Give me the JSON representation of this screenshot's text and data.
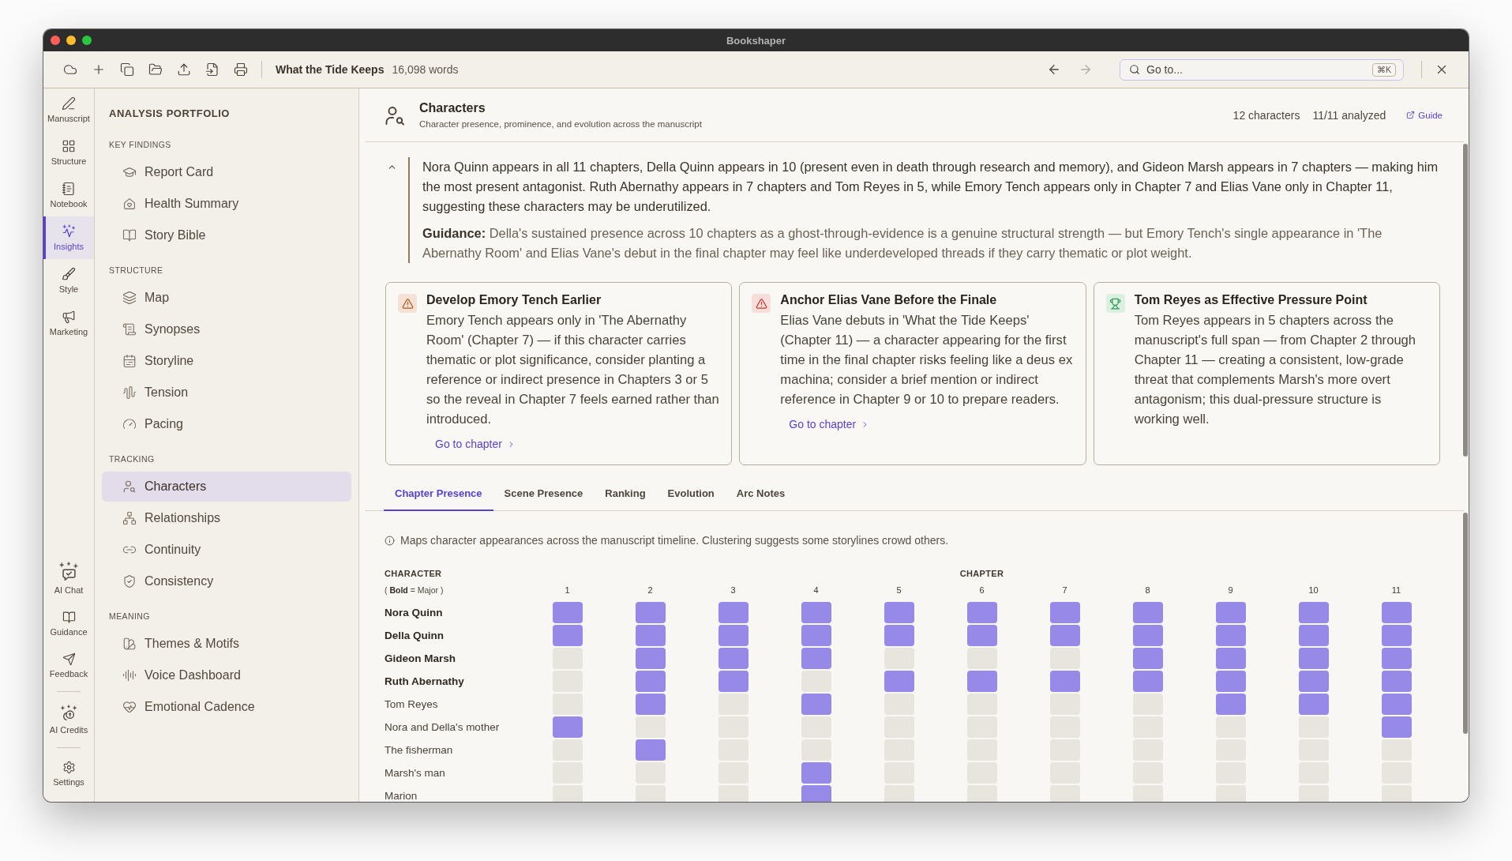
{
  "window": {
    "title": "Bookshaper"
  },
  "toolbar": {
    "document_title": "What the Tide Keeps",
    "word_count": "16,098 words",
    "navigation": [
      {
        "kind": "back",
        "disabled": false
      },
      {
        "kind": "forward",
        "disabled": true
      }
    ],
    "search": {
      "placeholder": "Go to...",
      "shortcut": "⌘K"
    }
  },
  "rail": {
    "items": [
      {
        "label": "Manuscript",
        "selected": false
      },
      {
        "label": "Structure",
        "selected": false
      },
      {
        "label": "Notebook",
        "selected": false
      },
      {
        "label": "Insights",
        "selected": true
      },
      {
        "label": "Style",
        "selected": false
      },
      {
        "label": "Marketing",
        "selected": false
      }
    ],
    "footer_groups": [
      {
        "items": [
          {
            "label": "AI Chat",
            "selected": false
          },
          {
            "label": "Guidance",
            "selected": false
          },
          {
            "label": "Feedback",
            "selected": false
          }
        ]
      },
      {
        "items": [
          {
            "label": "AI Credits",
            "selected": false
          }
        ]
      },
      {
        "items": [
          {
            "label": "Settings",
            "selected": false
          }
        ]
      }
    ]
  },
  "sidebar": {
    "title": "ANALYSIS PORTFOLIO",
    "sections": [
      {
        "heading": "KEY FINDINGS",
        "items": [
          {
            "label": "Report Card",
            "selected": false
          },
          {
            "label": "Health Summary",
            "selected": false
          },
          {
            "label": "Story Bible",
            "selected": false
          }
        ]
      },
      {
        "heading": "STRUCTURE",
        "items": [
          {
            "label": "Map",
            "selected": false
          },
          {
            "label": "Synopses",
            "selected": false
          },
          {
            "label": "Storyline",
            "selected": false
          },
          {
            "label": "Tension",
            "selected": false
          },
          {
            "label": "Pacing",
            "selected": false
          }
        ]
      },
      {
        "heading": "TRACKING",
        "items": [
          {
            "label": "Characters",
            "selected": true
          },
          {
            "label": "Relationships",
            "selected": false
          },
          {
            "label": "Continuity",
            "selected": false
          },
          {
            "label": "Consistency",
            "selected": false
          }
        ]
      },
      {
        "heading": "MEANING",
        "items": [
          {
            "label": "Themes & Motifs",
            "selected": false
          },
          {
            "label": "Voice Dashboard",
            "selected": false
          },
          {
            "label": "Emotional Cadence",
            "selected": false
          }
        ]
      }
    ]
  },
  "main": {
    "header": {
      "title": "Characters",
      "subtitle": "Character presence, prominence, and evolution across the manuscript",
      "stats": [
        "12 characters",
        "11/11 analyzed"
      ],
      "guide_link": "Guide"
    },
    "summary": {
      "expanded": true,
      "text": "Nora Quinn appears in all 11 chapters, Della Quinn appears in 10 (present even in death through research and memory), and Gideon Marsh appears in 7 chapters — making him the most present antagonist. Ruth Abernathy appears in 7 chapters and Tom Reyes in 5, while Emory Tench appears only in Chapter 7 and Elias Vane only in Chapter 11, suggesting these characters may be underutilized.",
      "guidance": "**Guidance:** Della's sustained presence across 10 chapters as a ghost-through-evidence is a genuine structural strength — but Emory Tench's single appearance in 'The Abernathy Room' and Elias Vane's debut in the final chapter may feel like underdeveloped threads if they carry thematic or plot weight."
    },
    "cards": [
      {
        "kind": "warning",
        "title": "Develop Emory Tench Earlier",
        "body": "Emory Tench appears only in 'The Abernathy Room' (Chapter 7) — if this character carries thematic or plot significance, consider planting a reference or indirect presence in Chapters 3 or 5 so the reveal in Chapter 7 feels earned rather than introduced.",
        "link": "Go to chapter"
      },
      {
        "kind": "alert",
        "title": "Anchor Elias Vane Before the Finale",
        "body": "Elias Vane debuts in 'What the Tide Keeps' (Chapter 11) — a character appearing for the first time in the final chapter risks feeling like a deus ex machina; consider a brief mention or indirect reference in Chapter 9 or 10 to prepare readers.",
        "link": "Go to chapter"
      },
      {
        "kind": "strength",
        "title": "Tom Reyes as Effective Pressure Point",
        "body": "Tom Reyes appears in 5 chapters across the manuscript's full span — from Chapter 2 through Chapter 11 — creating a consistent, low-grade threat that complements Marsh's more overt antagonism; this dual-pressure structure is working well."
      }
    ],
    "tabs": [
      {
        "label": "Chapter Presence",
        "selected": true
      },
      {
        "label": "Scene Presence",
        "selected": false
      },
      {
        "label": "Ranking",
        "selected": false
      },
      {
        "label": "Evolution",
        "selected": false
      },
      {
        "label": "Arc Notes",
        "selected": false
      }
    ],
    "presence": {
      "note": "Maps character appearances across the manuscript timeline. Clustering suggests some storylines crowd others.",
      "character_heading": "CHARACTER",
      "legend": "( **Bold** = Major )",
      "chapter_heading": "CHAPTER",
      "chapters": [
        "1",
        "2",
        "3",
        "4",
        "5",
        "6",
        "7",
        "8",
        "9",
        "10",
        "11"
      ],
      "rows": [
        {
          "name": "Nora Quinn",
          "major": true,
          "present": [
            true,
            true,
            true,
            true,
            true,
            true,
            true,
            true,
            true,
            true,
            true
          ]
        },
        {
          "name": "Della Quinn",
          "major": true,
          "present": [
            true,
            true,
            true,
            true,
            true,
            true,
            true,
            true,
            true,
            true,
            true
          ]
        },
        {
          "name": "Gideon Marsh",
          "major": true,
          "present": [
            false,
            true,
            true,
            true,
            false,
            false,
            false,
            true,
            true,
            true,
            true
          ]
        },
        {
          "name": "Ruth Abernathy",
          "major": true,
          "present": [
            false,
            true,
            true,
            false,
            true,
            true,
            true,
            true,
            true,
            true,
            true
          ]
        },
        {
          "name": "Tom Reyes",
          "major": false,
          "present": [
            false,
            true,
            false,
            true,
            false,
            false,
            false,
            false,
            true,
            true,
            true
          ]
        },
        {
          "name": "Nora and Della's mother",
          "major": false,
          "present": [
            true,
            false,
            false,
            false,
            false,
            false,
            false,
            false,
            false,
            false,
            true
          ]
        },
        {
          "name": "The fisherman",
          "major": false,
          "present": [
            false,
            true,
            false,
            false,
            false,
            false,
            false,
            false,
            false,
            false,
            false
          ]
        },
        {
          "name": "Marsh's man",
          "major": false,
          "present": [
            false,
            false,
            false,
            true,
            false,
            false,
            false,
            false,
            false,
            false,
            false
          ]
        },
        {
          "name": "Marion",
          "major": false,
          "present": [
            false,
            false,
            false,
            true,
            false,
            false,
            false,
            false,
            false,
            false,
            false
          ]
        }
      ]
    }
  }
}
